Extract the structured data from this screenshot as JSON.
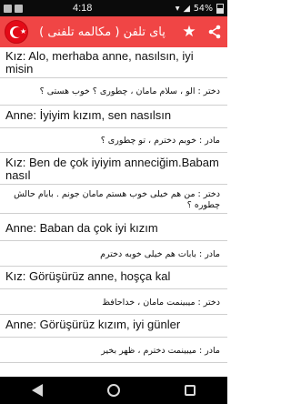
{
  "status_bar": {
    "time": "4:18",
    "battery": "54%"
  },
  "app_bar": {
    "title": "پای تلفن ( مکالمه تلفنی )"
  },
  "dialogue": [
    {
      "lang": "tr",
      "text": "Kız: Alo, merhaba anne, nasılsın, iyi misin"
    },
    {
      "lang": "fa",
      "text": "دختر : الو ، سلام مامان ، چطوری ؟ خوب هستی ؟"
    },
    {
      "lang": "tr",
      "text": "Anne: İyiyim kızım, sen nasılsın"
    },
    {
      "lang": "fa",
      "text": "مادر : خوبم دخترم ، تو چطوری ؟"
    },
    {
      "lang": "tr",
      "text": "Kız: Ben de çok iyiyim anneciğim.Babam nasıl"
    },
    {
      "lang": "fa",
      "text": "دختر : من هم خیلی خوب هستم مامان جونم . بابام حالش چطوره ؟"
    },
    {
      "lang": "tr",
      "text": "Anne: Baban da çok iyi kızım"
    },
    {
      "lang": "fa",
      "text": "مادر : بابات هم خیلی خوبه دخترم"
    },
    {
      "lang": "tr",
      "text": "Kız: Görüşürüz anne, hoşça kal"
    },
    {
      "lang": "fa",
      "text": "دختر : میبینمت مامان ، خداحافظ"
    },
    {
      "lang": "tr",
      "text": "Anne: Görüşürüz kızım, iyi günler"
    },
    {
      "lang": "fa",
      "text": "مادر : میبینمت دخترم ، ظهر بخیر"
    }
  ]
}
